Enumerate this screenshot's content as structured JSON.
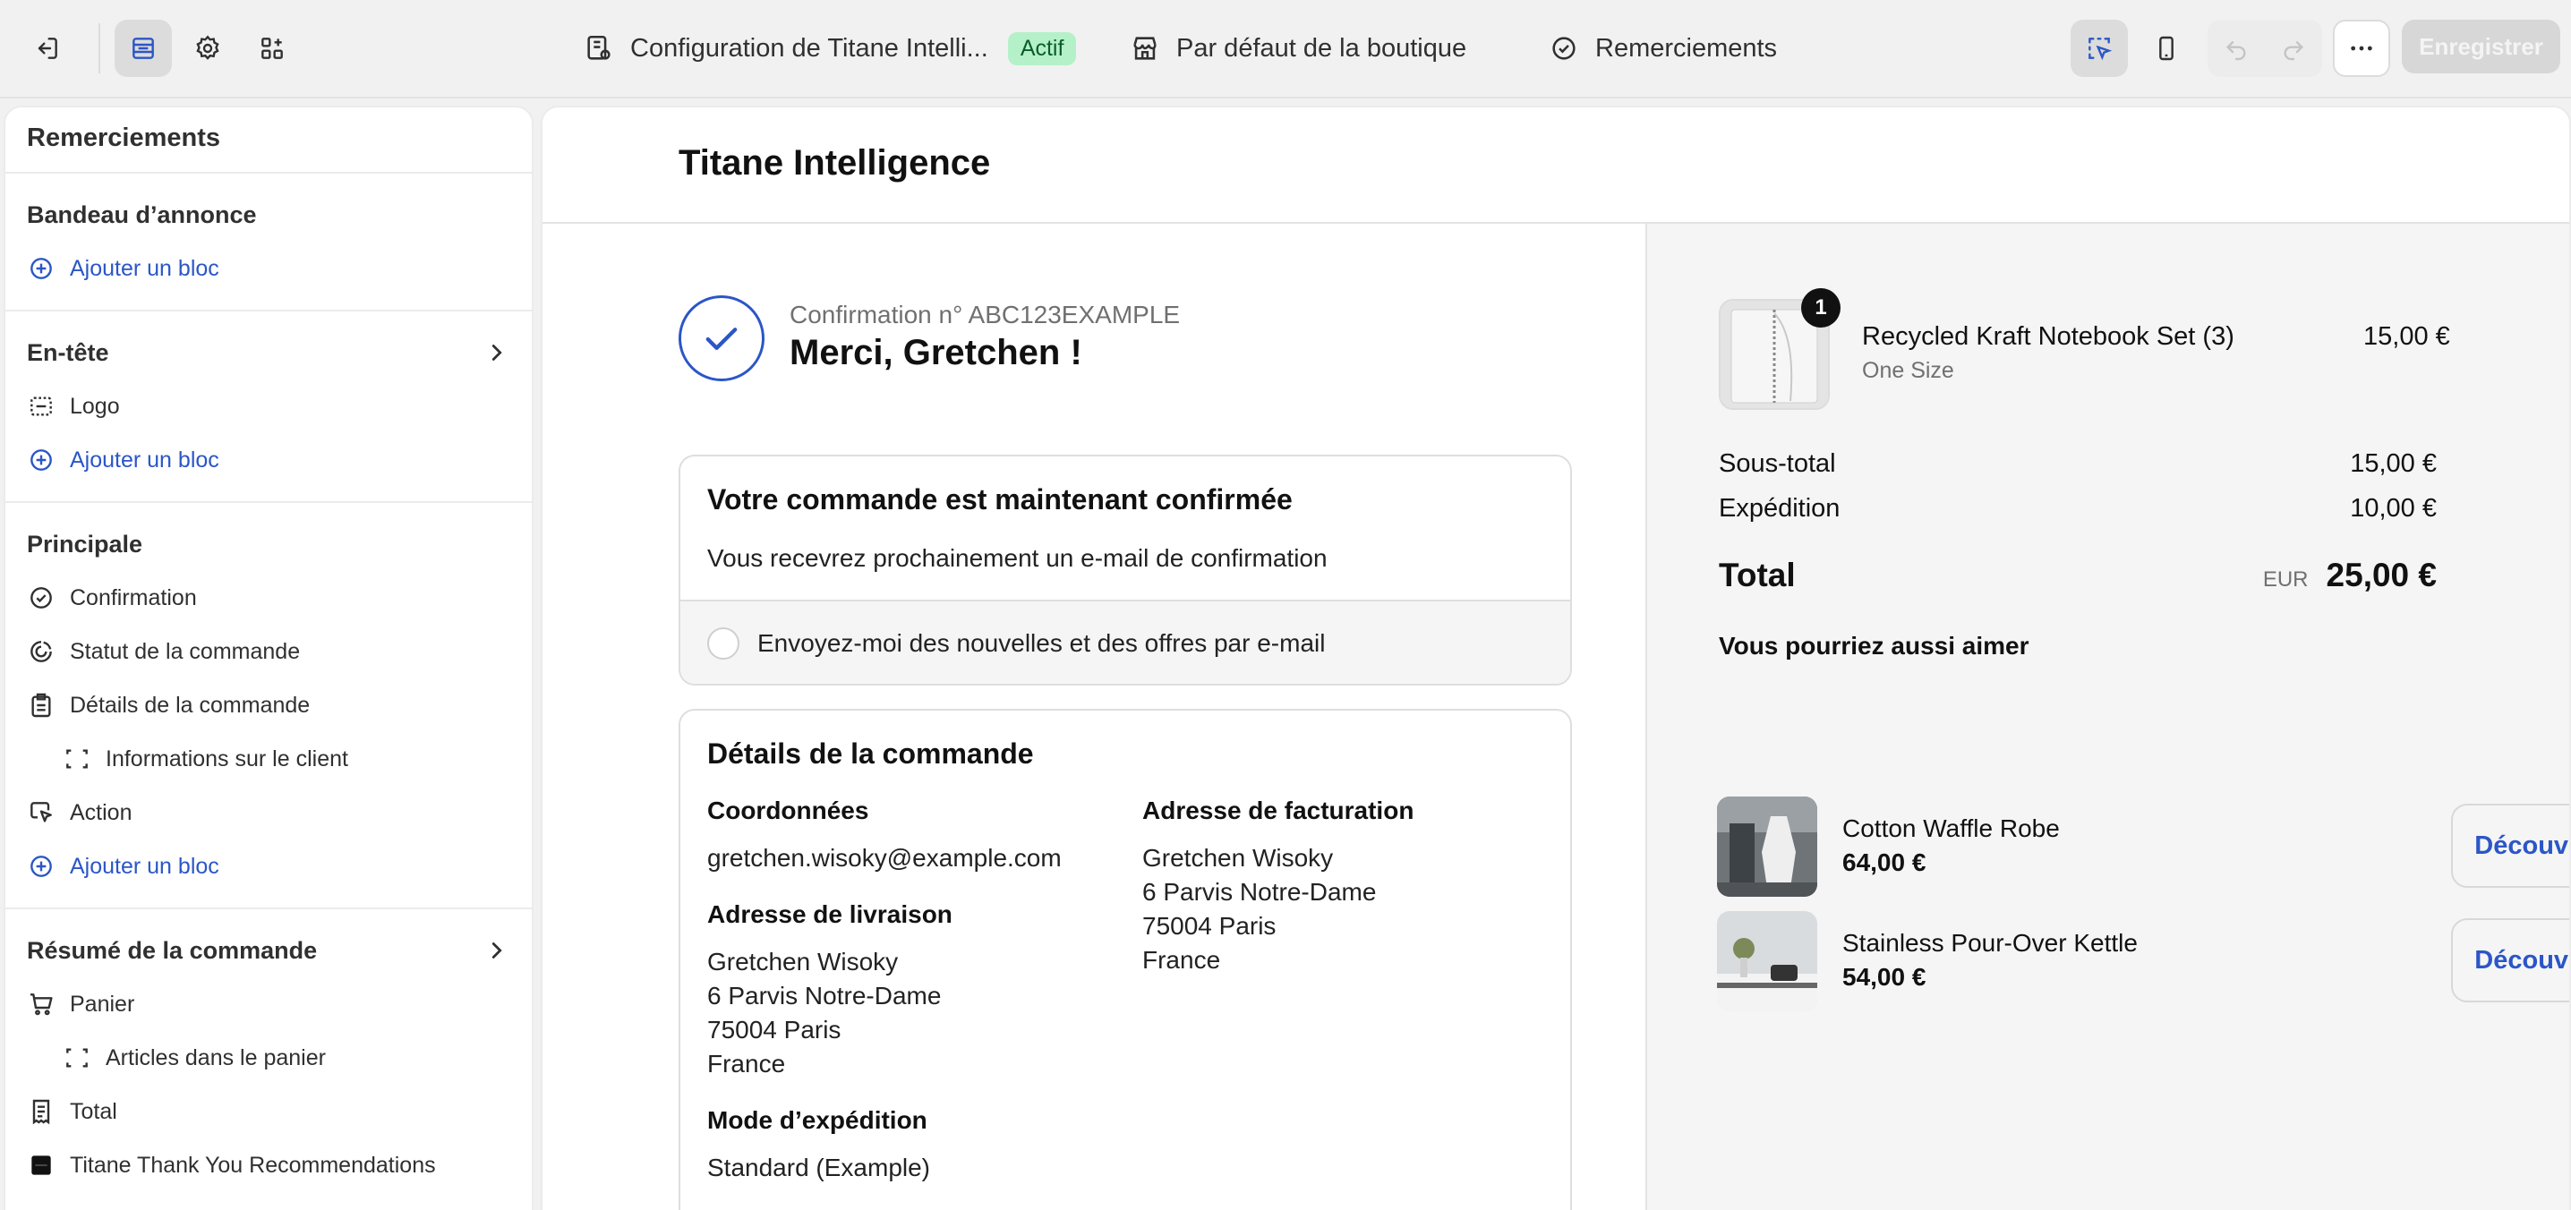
{
  "topbar": {
    "config_label": "Configuration de Titane Intelli...",
    "active_badge": "Actif",
    "default_label": "Par défaut de la boutique",
    "page_label": "Remerciements",
    "save_label": "Enregistrer"
  },
  "sidebar": {
    "title": "Remerciements",
    "announcement": {
      "head": "Bandeau d’annonce",
      "add": "Ajouter un bloc"
    },
    "header": {
      "head": "En-tête",
      "logo": "Logo",
      "add": "Ajouter un bloc"
    },
    "main": {
      "head": "Principale",
      "items": [
        "Confirmation",
        "Statut de la commande",
        "Détails de la commande",
        "Informations sur le client",
        "Action"
      ],
      "add": "Ajouter un bloc"
    },
    "summary": {
      "head": "Résumé de la commande",
      "items": [
        "Panier",
        "Articles dans le panier",
        "Total",
        "Titane Thank You Recommendations"
      ]
    }
  },
  "preview": {
    "shop_name": "Titane Intelligence",
    "confirmation_no": "Confirmation n° ABC123EXAMPLE",
    "thanks": "Merci, Gretchen !",
    "confirmed_card": {
      "title": "Votre commande est maintenant confirmée",
      "text": "Vous recevrez prochainement un e-mail de confirmation",
      "newsletter": "Envoyez-moi des nouvelles et des offres par e-mail"
    },
    "details": {
      "title": "Détails de la commande",
      "contact_h": "Coordonnées",
      "contact_v": "gretchen.wisoky@example.com",
      "shipping_h": "Adresse de livraison",
      "shipping_lines": [
        "Gretchen Wisoky",
        "6 Parvis Notre-Dame",
        "75004 Paris",
        "France"
      ],
      "billing_h": "Adresse de facturation",
      "billing_lines": [
        "Gretchen Wisoky",
        "6 Parvis Notre-Dame",
        "75004 Paris",
        "France"
      ],
      "method_h": "Mode d’expédition",
      "method_v": "Standard (Example)"
    },
    "summary": {
      "product": {
        "name": "Recycled Kraft Notebook Set (3)",
        "variant": "One Size",
        "price": "15,00 €",
        "qty": "1"
      },
      "subtotal_label": "Sous-total",
      "subtotal": "15,00 €",
      "shipping_label": "Expédition",
      "shipping": "10,00 €",
      "total_label": "Total",
      "currency": "EUR",
      "total": "25,00 €",
      "reco_title": "Vous pourriez aussi aimer",
      "recos": [
        {
          "name": "Cotton Waffle Robe",
          "price": "64,00 €",
          "button": "Découvrir"
        },
        {
          "name": "Stainless Pour-Over Kettle",
          "price": "54,00 €",
          "button": "Découvrir"
        }
      ]
    }
  },
  "colors": {
    "accent": "#2b56c7",
    "active_badge_bg": "#b4f1c9",
    "save_disabled": "#d7d7d7"
  }
}
